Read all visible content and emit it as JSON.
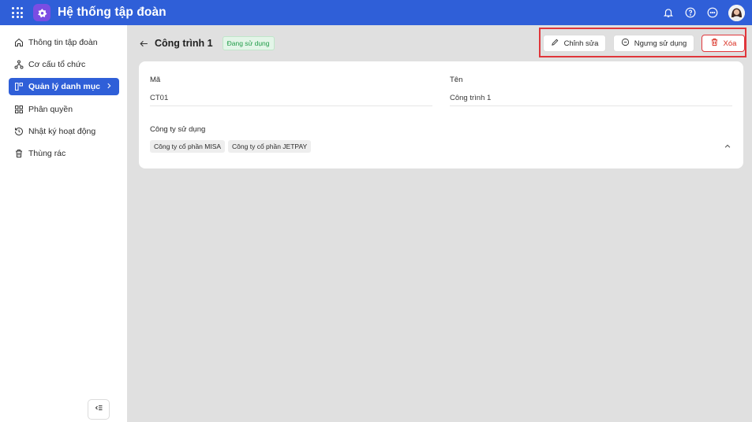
{
  "app": {
    "title": "Hệ thống tập đoàn"
  },
  "sidebar": {
    "items": [
      {
        "label": "Thông tin tập đoàn"
      },
      {
        "label": "Cơ cấu tổ chức"
      },
      {
        "label": "Quản lý danh mục",
        "active": true
      },
      {
        "label": "Phân quyền"
      },
      {
        "label": "Nhật ký hoạt động"
      },
      {
        "label": "Thùng rác"
      }
    ]
  },
  "page": {
    "title": "Công trình 1",
    "status": "Đang sử dụng"
  },
  "actions": {
    "edit_label": "Chỉnh sửa",
    "stop_label": "Ngưng sử dụng",
    "delete_label": "Xóa"
  },
  "details": {
    "code_label": "Mã",
    "code_value": "CT01",
    "name_label": "Tên",
    "name_value": "Công trình 1",
    "companies_label": "Công ty sử dụng",
    "companies": [
      "Công ty cổ phần MISA",
      "Công ty cổ phần JETPAY"
    ]
  },
  "colors": {
    "topbar": "#2f5fd8",
    "logo": "#7b4de3",
    "active_nav": "#2f5fd8",
    "status_green": "#1e9b47",
    "danger": "#d92d20",
    "highlight": "#e0363b"
  }
}
